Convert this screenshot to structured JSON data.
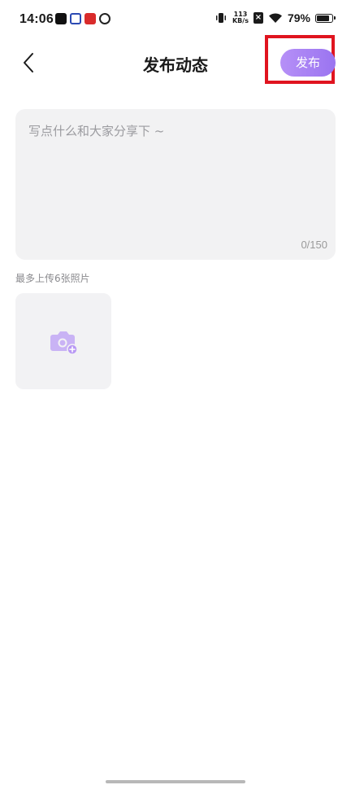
{
  "status_bar": {
    "time": "14:06",
    "net_speed_value": "113",
    "net_speed_unit": "KB/s",
    "battery": "79%",
    "app_icons": [
      "tiktok-icon",
      "blue-app-icon",
      "red-app-icon",
      "swirl-app-icon"
    ]
  },
  "header": {
    "title": "发布动态",
    "publish_label": "发布"
  },
  "post": {
    "placeholder": "写点什么和大家分享下 ~",
    "char_count": "0/150"
  },
  "upload": {
    "hint": "最多上传6张照片"
  },
  "colors": {
    "accent": "#9f7bf2",
    "highlight": "#e0141f",
    "input_bg": "#f2f2f3"
  }
}
